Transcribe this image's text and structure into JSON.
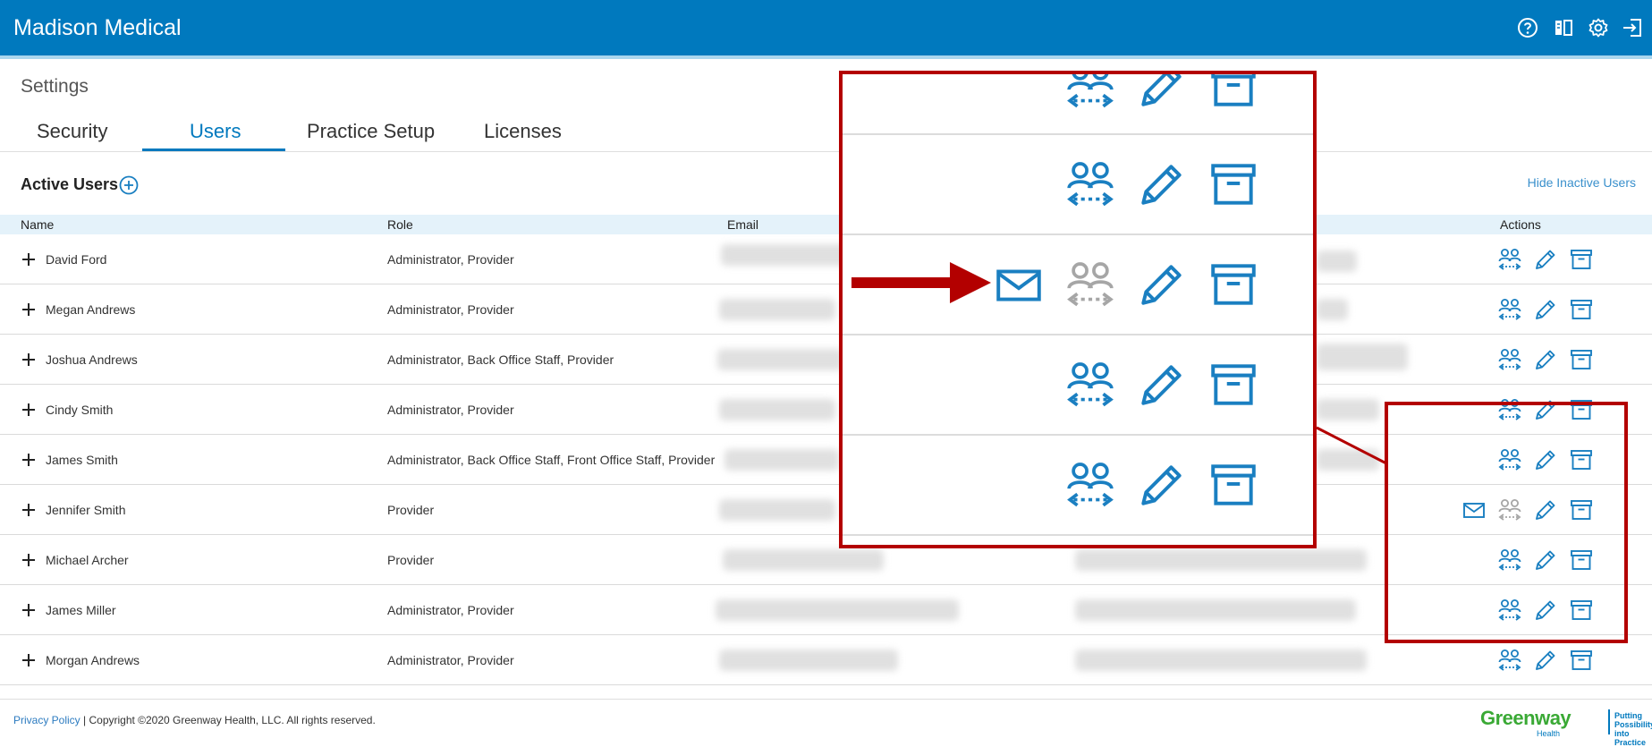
{
  "app": {
    "title": "Madison Medical"
  },
  "header_icons": [
    "help-circle-icon",
    "book-icon",
    "gear-icon",
    "logout-icon"
  ],
  "settings": {
    "label": "Settings",
    "tabs": [
      {
        "label": "Security",
        "active": false
      },
      {
        "label": "Users",
        "active": true
      },
      {
        "label": "Practice Setup",
        "active": false
      },
      {
        "label": "Licenses",
        "active": false
      }
    ]
  },
  "users": {
    "section_title": "Active Users",
    "hide_inactive_label": "Hide Inactive Users",
    "columns": {
      "name": "Name",
      "role": "Role",
      "email": "Email",
      "actions": "Actions"
    },
    "rows": [
      {
        "name": "David Ford",
        "role": "Administrator, Provider",
        "invite_pending": false
      },
      {
        "name": "Megan Andrews",
        "role": "Administrator, Provider",
        "invite_pending": false
      },
      {
        "name": "Joshua Andrews",
        "role": "Administrator, Back Office Staff, Provider",
        "invite_pending": false
      },
      {
        "name": "Cindy Smith",
        "role": "Administrator, Provider",
        "invite_pending": false
      },
      {
        "name": "James Smith",
        "role": "Administrator, Back Office Staff, Front Office Staff, Provider",
        "invite_pending": false
      },
      {
        "name": "Jennifer Smith",
        "role": "Provider",
        "invite_pending": true
      },
      {
        "name": "Michael Archer",
        "role": "Provider",
        "invite_pending": false
      },
      {
        "name": "James Miller",
        "role": "Administrator, Provider",
        "invite_pending": false
      },
      {
        "name": "Morgan Andrews",
        "role": "Administrator, Provider",
        "invite_pending": false
      }
    ],
    "action_icons": [
      "envelope-icon",
      "switch-users-icon",
      "pencil-icon",
      "archive-icon"
    ]
  },
  "footer": {
    "privacy_link": "Privacy Policy",
    "copyright": " | Copyright ©2020 Greenway Health, LLC. All rights reserved.",
    "logo_name": "Greenway",
    "logo_sub": "Health",
    "logo_tagline": "Putting Possibility into Practice"
  },
  "colors": {
    "brand_blue": "#0079be",
    "header_accent": "#a9d6ee",
    "table_header_bg": "#e4f2fa",
    "icon_blue": "#1a7fc1",
    "icon_disabled": "#a6a6a6",
    "callout_red": "#b30000",
    "logo_green": "#3aa935"
  }
}
